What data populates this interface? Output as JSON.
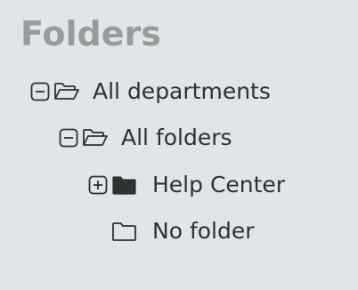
{
  "panel": {
    "title": "Folders"
  },
  "tree": {
    "items": [
      {
        "label": "All departments",
        "toggle": "collapse",
        "icon": "folder-open-icon"
      },
      {
        "label": "All folders",
        "toggle": "collapse",
        "icon": "folder-open-icon"
      },
      {
        "label": "Help Center",
        "toggle": "expand",
        "icon": "folder-filled-icon"
      },
      {
        "label": "No folder",
        "toggle": "none",
        "icon": "folder-outline-icon"
      }
    ]
  }
}
